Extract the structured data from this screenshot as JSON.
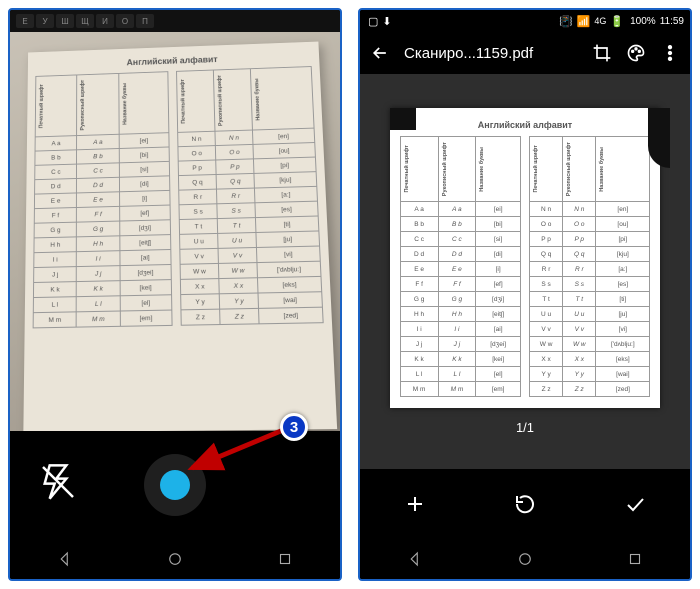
{
  "left": {
    "keyboard_keys": [
      "Е",
      "У",
      "Ш",
      "Щ",
      "И",
      "О",
      "П"
    ],
    "doc_title": "Английский алфавит",
    "header_cols": [
      "Печатный шрифт",
      "Рукописный шрифт",
      "Название буквы"
    ],
    "rows_left": [
      {
        "p": "A a",
        "r": "A a",
        "n": "[ei]"
      },
      {
        "p": "B b",
        "r": "B b",
        "n": "[bi]"
      },
      {
        "p": "C c",
        "r": "C c",
        "n": "[si]"
      },
      {
        "p": "D d",
        "r": "D d",
        "n": "[di]"
      },
      {
        "p": "E e",
        "r": "E e",
        "n": "[i]"
      },
      {
        "p": "F f",
        "r": "F f",
        "n": "[ef]"
      },
      {
        "p": "G g",
        "r": "G g",
        "n": "[dʒi]"
      },
      {
        "p": "H h",
        "r": "H h",
        "n": "[eitʃ]"
      },
      {
        "p": "I i",
        "r": "I i",
        "n": "[ai]"
      },
      {
        "p": "J j",
        "r": "J j",
        "n": "[dʒei]"
      },
      {
        "p": "K k",
        "r": "K k",
        "n": "[kei]"
      },
      {
        "p": "L l",
        "r": "L l",
        "n": "[el]"
      },
      {
        "p": "M m",
        "r": "M m",
        "n": "[em]"
      }
    ],
    "rows_right": [
      {
        "p": "N n",
        "r": "N n",
        "n": "[en]"
      },
      {
        "p": "O o",
        "r": "O o",
        "n": "[ou]"
      },
      {
        "p": "P p",
        "r": "P p",
        "n": "[pi]"
      },
      {
        "p": "Q q",
        "r": "Q q",
        "n": "[kju]"
      },
      {
        "p": "R r",
        "r": "R r",
        "n": "[a:]"
      },
      {
        "p": "S s",
        "r": "S s",
        "n": "[es]"
      },
      {
        "p": "T t",
        "r": "T t",
        "n": "[ti]"
      },
      {
        "p": "U u",
        "r": "U u",
        "n": "[ju]"
      },
      {
        "p": "V v",
        "r": "V v",
        "n": "[vi]"
      },
      {
        "p": "W w",
        "r": "W w",
        "n": "['dʌblju:]"
      },
      {
        "p": "X x",
        "r": "X x",
        "n": "[eks]"
      },
      {
        "p": "Y y",
        "r": "Y y",
        "n": "[wai]"
      },
      {
        "p": "Z z",
        "r": "Z z",
        "n": "[zed]"
      }
    ]
  },
  "right": {
    "status": {
      "battery": "100%",
      "time": "11:59"
    },
    "appbar_title": "Сканиро...1159.pdf",
    "doc_title": "Английский алфавит",
    "page_counter": "1/1"
  },
  "annotation": {
    "badge": "3"
  }
}
